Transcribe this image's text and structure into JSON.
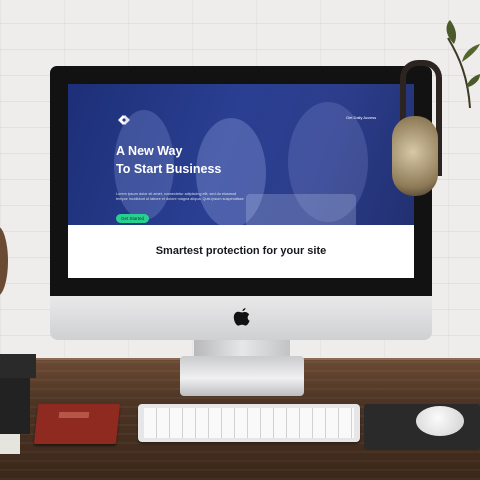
{
  "website": {
    "hero_title_line1": "A New Way",
    "hero_title_line2": "To Start Business",
    "hero_description": "Lorem ipsum dolor sit amet, consectetur adipiscing elit, sed do eiusmod tempor incididunt ut labore et dolore magna aliqua. Quis ipsum suspendisse",
    "cta_button": "Get Started",
    "top_link": "Get Daily Access",
    "banner_title": "Smartest protection for your site"
  },
  "colors": {
    "hero_bg": "#2a3f92",
    "cta": "#27d08e"
  },
  "icons": {
    "logo": "site-logo-icon",
    "computer_brand": "apple-logo-icon"
  }
}
